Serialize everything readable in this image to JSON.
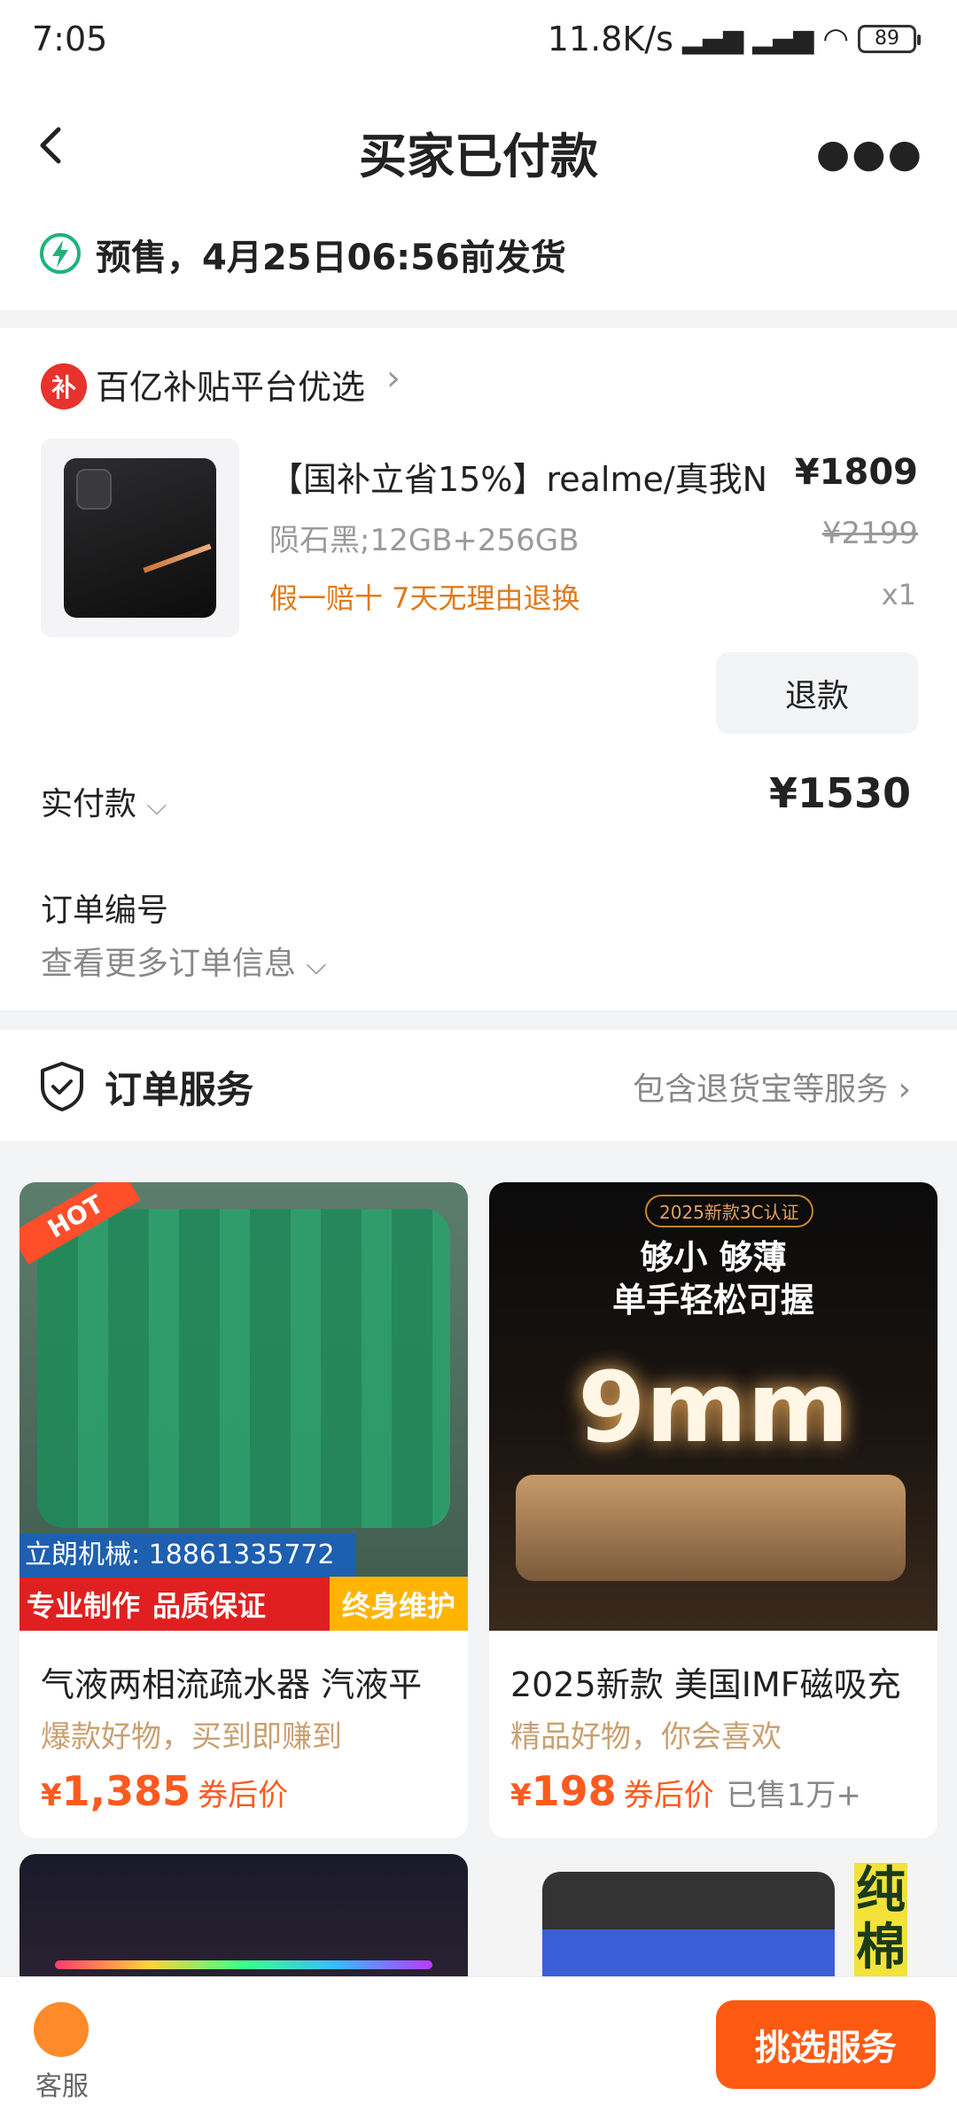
{
  "status": {
    "time": "7:05",
    "net": "11.8K/s",
    "battery": "89"
  },
  "header": {
    "title": "买家已付款"
  },
  "presale": {
    "text": "预售，4月25日06:56前发货"
  },
  "order": {
    "shop_badge": "补",
    "shop_name": "百亿补贴平台优选",
    "product_title": "【国补立省15%】realme/真我N",
    "price": "¥1809",
    "spec": "陨石黑;12GB+256GB",
    "original_price": "¥2199",
    "tags": "假一赔十  7天无理由退换",
    "quantity": "x1",
    "refund_label": "退款",
    "paid_label": "实付款",
    "paid_value": "¥1530",
    "order_no_label": "订单编号",
    "more_info": "查看更多订单信息"
  },
  "service": {
    "title": "订单服务",
    "right": "包含退货宝等服务"
  },
  "recommend": [
    {
      "title": "气液两相流疏水器 汽液平",
      "subtitle": "爆款好物，买到即赚到",
      "price": "1,385",
      "coupon": "券后价",
      "sold": "",
      "img_banner": "立朗机械: 18861335772",
      "img_left": "专业制作",
      "img_mid": "品质保证",
      "img_right": "终身维护",
      "hot": "HOT"
    },
    {
      "title": "2025新款 美国IMF磁吸充",
      "subtitle": "精品好物，你会喜欢",
      "price": "198",
      "coupon": "券后价",
      "sold": "已售1万+",
      "img_badge": "2025新款3C认证",
      "img_head1": "够小 够薄",
      "img_head2": "单手轻松可握",
      "img_big": "9mm"
    }
  ],
  "recommend_more": [
    {
      "side_text": "纯棉"
    }
  ],
  "bottom": {
    "kf_label": "客服",
    "pick_label": "挑选服务"
  },
  "currency": "¥",
  "colors": {
    "accent": "#ff5a12",
    "tag": "#e07a1a",
    "gold": "#c9a070"
  }
}
